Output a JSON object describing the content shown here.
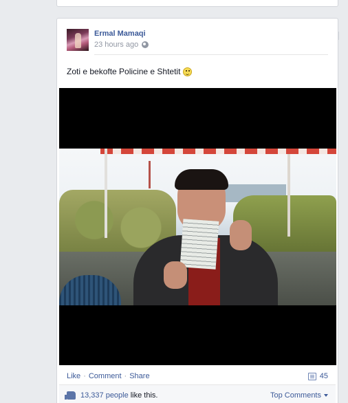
{
  "post": {
    "author": "Ermal Mamaqi",
    "timestamp": "23 hours ago",
    "privacy_icon": "globe-icon",
    "status_text": "Zoti e bekofte Policine e Shtetit",
    "emoticon": "smiley-icon"
  },
  "actions": {
    "like": "Like",
    "separator": "·",
    "comment": "Comment",
    "share": "Share",
    "comment_count": "45"
  },
  "likes": {
    "count": "13,337 people",
    "suffix": "like this.",
    "sort_label": "Top Comments"
  },
  "colors": {
    "link": "#3b5998",
    "background": "#e9ebee",
    "muted": "#9197a3"
  }
}
